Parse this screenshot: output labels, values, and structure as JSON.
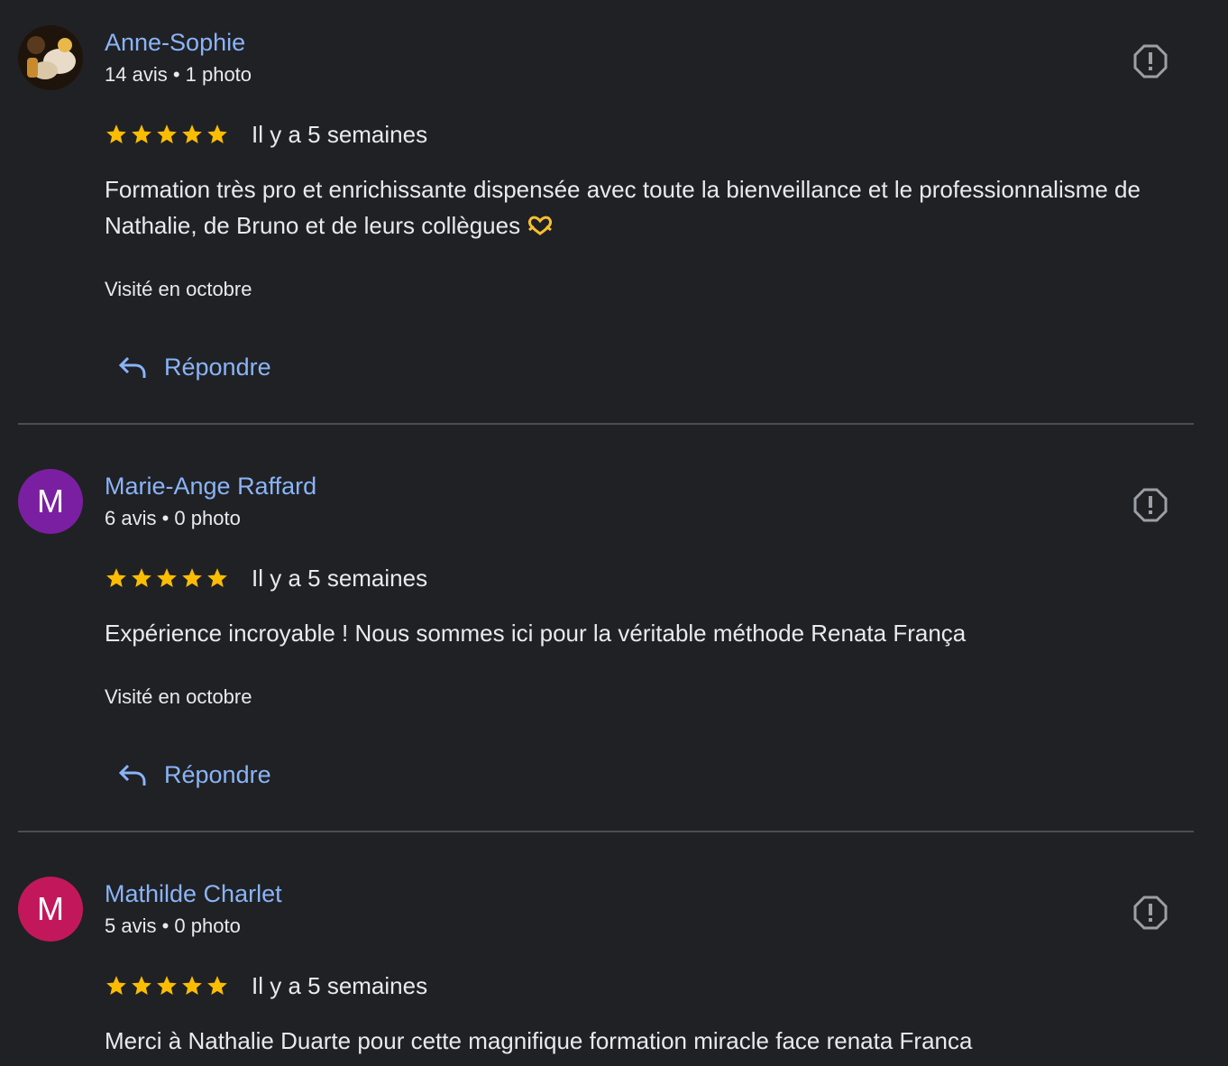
{
  "reviews": [
    {
      "author": "Anne-Sophie",
      "meta": "14 avis • 1 photo",
      "avatar_letter": "",
      "avatar_color": "#3b2a1c",
      "rating": 5,
      "time": "Il y a 5 semaines",
      "text": "Formation très pro et enrichissante dispensée avec toute la bienveillance et le professionnalisme de Nathalie, de Bruno et de leurs collègues",
      "emoji_icon": "heart-hands-icon",
      "visited": "Visité en octobre",
      "reply_label": "Répondre"
    },
    {
      "author": "Marie-Ange Raffard",
      "meta": "6 avis • 0 photo",
      "avatar_letter": "M",
      "avatar_color": "#7b1fa2",
      "rating": 5,
      "time": "Il y a 5 semaines",
      "text": "Expérience incroyable ! Nous sommes ici pour la véritable méthode Renata França",
      "visited": "Visité en octobre",
      "reply_label": "Répondre"
    },
    {
      "author": "Mathilde Charlet",
      "meta": "5 avis • 0 photo",
      "avatar_letter": "M",
      "avatar_color": "#c2185b",
      "rating": 5,
      "time": "Il y a 5 semaines",
      "text": "Merci à Nathalie Duarte pour cette magnifique formation miracle face renata Franca"
    }
  ],
  "colors": {
    "background": "#202124",
    "link": "#8ab4f8",
    "star": "#fbbc04",
    "divider": "#4a4d52",
    "text": "#e8eaed"
  }
}
